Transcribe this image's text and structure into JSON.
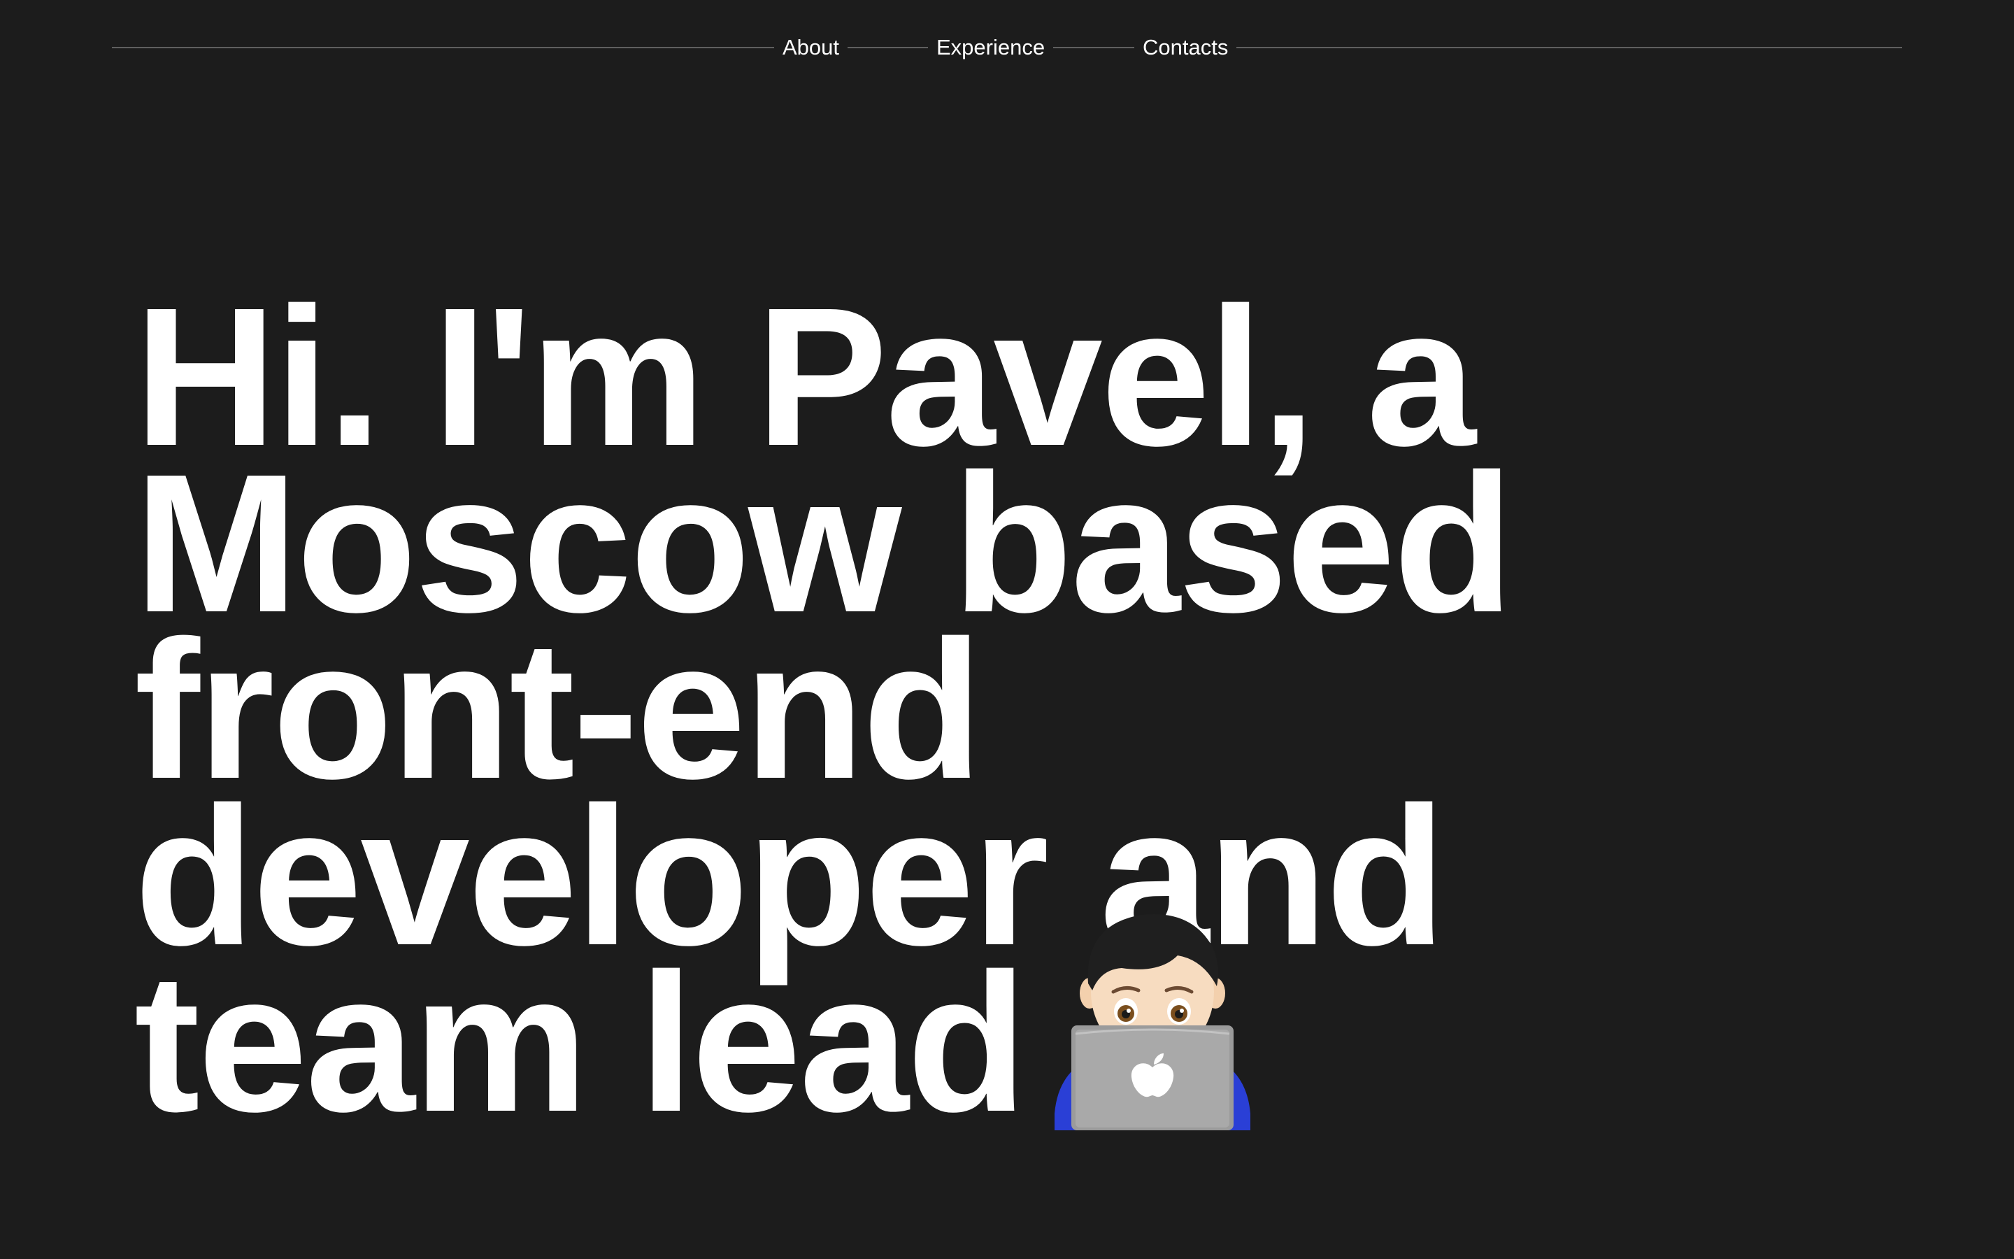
{
  "nav": {
    "items": [
      {
        "label": "About"
      },
      {
        "label": "Experience"
      },
      {
        "label": "Contacts"
      }
    ]
  },
  "hero": {
    "lines": [
      "Hi. I'm Pavel, a",
      "Moscow based",
      "front-end",
      "developer and",
      "team lead"
    ]
  },
  "emoji": {
    "icon": "technologist-with-laptop-icon"
  },
  "colors": {
    "background": "#1c1c1c",
    "text": "#ffffff",
    "rule": "#5f5f5f"
  }
}
